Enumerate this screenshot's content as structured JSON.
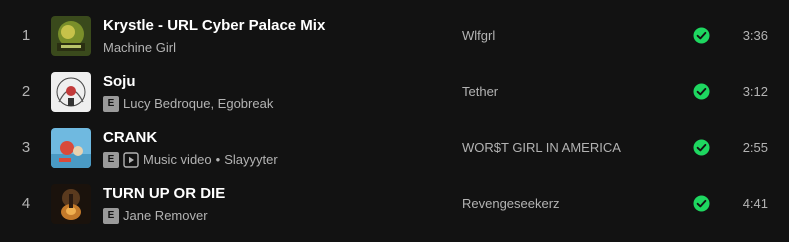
{
  "colors": {
    "background": "#121212",
    "primary_text": "#ffffff",
    "secondary_text": "#b3b3b3",
    "saved_green": "#1ed760"
  },
  "tracks": [
    {
      "index": "1",
      "title": "Krystle - URL Cyber Palace Mix",
      "explicit": false,
      "music_video": false,
      "artists": "Machine Girl",
      "album": "Wlfgrl",
      "duration": "3:36",
      "saved_icon": "check-circle-icon"
    },
    {
      "index": "2",
      "title": "Soju",
      "explicit": true,
      "explicit_label": "E",
      "music_video": false,
      "artists": "Lucy Bedroque, Egobreak",
      "album": "Tether",
      "duration": "3:12",
      "saved_icon": "check-circle-icon"
    },
    {
      "index": "3",
      "title": "CRANK",
      "explicit": true,
      "explicit_label": "E",
      "music_video": true,
      "music_video_label": "Music video",
      "separator": "•",
      "artists": "Slayyyter",
      "album": "WOR$T GIRL IN AMERICA",
      "duration": "2:55",
      "saved_icon": "check-circle-icon"
    },
    {
      "index": "4",
      "title": "TURN UP OR DIE",
      "explicit": true,
      "explicit_label": "E",
      "music_video": false,
      "artists": "Jane Remover",
      "album": "Revengeseekerz",
      "duration": "4:41",
      "saved_icon": "check-circle-icon"
    }
  ]
}
